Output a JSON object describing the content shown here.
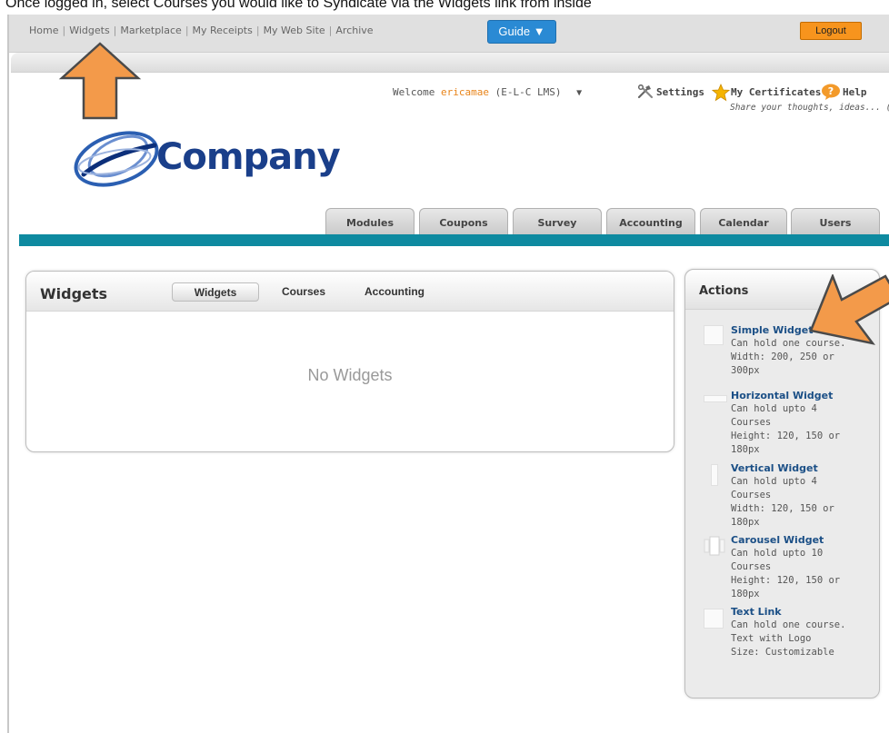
{
  "caption": "Once logged in, select Courses you would like to Syndicate via the Widgets link from inside",
  "top_nav": {
    "links": [
      "Home",
      "Widgets",
      "Marketplace",
      "My Receipts",
      "My Web Site",
      "Archive"
    ],
    "guide_label": "Guide ▼",
    "logout_label": "Logout"
  },
  "header": {
    "welcome_label": "Welcome",
    "username": "ericamae",
    "org": "(E-L-C LMS)",
    "settings_label": "Settings",
    "certificates_label": "My Certificates",
    "help_label": "Help",
    "share_text": "Share your thoughts, ideas... (click)",
    "logo_text": "Company"
  },
  "module_tabs": [
    "Modules",
    "Coupons",
    "Survey",
    "Accounting",
    "Calendar",
    "Users"
  ],
  "widgets_panel": {
    "title": "Widgets",
    "tabs": [
      "Widgets",
      "Courses",
      "Accounting"
    ],
    "empty_message": "No Widgets"
  },
  "actions_panel": {
    "title": "Actions",
    "items": [
      {
        "title": "Simple Widget",
        "lines": [
          "Can hold one course.",
          "Width: 200, 250 or",
          "300px"
        ]
      },
      {
        "title": "Horizontal Widget",
        "lines": [
          "Can hold upto 4",
          "Courses",
          "Height: 120, 150 or",
          "180px"
        ]
      },
      {
        "title": "Vertical Widget",
        "lines": [
          "Can hold upto 4",
          "Courses",
          "Width: 120, 150 or",
          "180px"
        ]
      },
      {
        "title": "Carousel Widget",
        "lines": [
          "Can hold upto 10",
          "Courses",
          "Height: 120, 150 or",
          "180px"
        ]
      },
      {
        "title": "Text Link",
        "lines": [
          "Can hold one course.",
          "Text with Logo",
          "Size: Customizable"
        ]
      }
    ]
  },
  "colors": {
    "accent_teal": "#0e8aa0",
    "guide_blue": "#2a8ad4",
    "logout_orange": "#f7941d",
    "annotation_orange": "#f39a4a",
    "link_blue": "#1b4f86"
  }
}
